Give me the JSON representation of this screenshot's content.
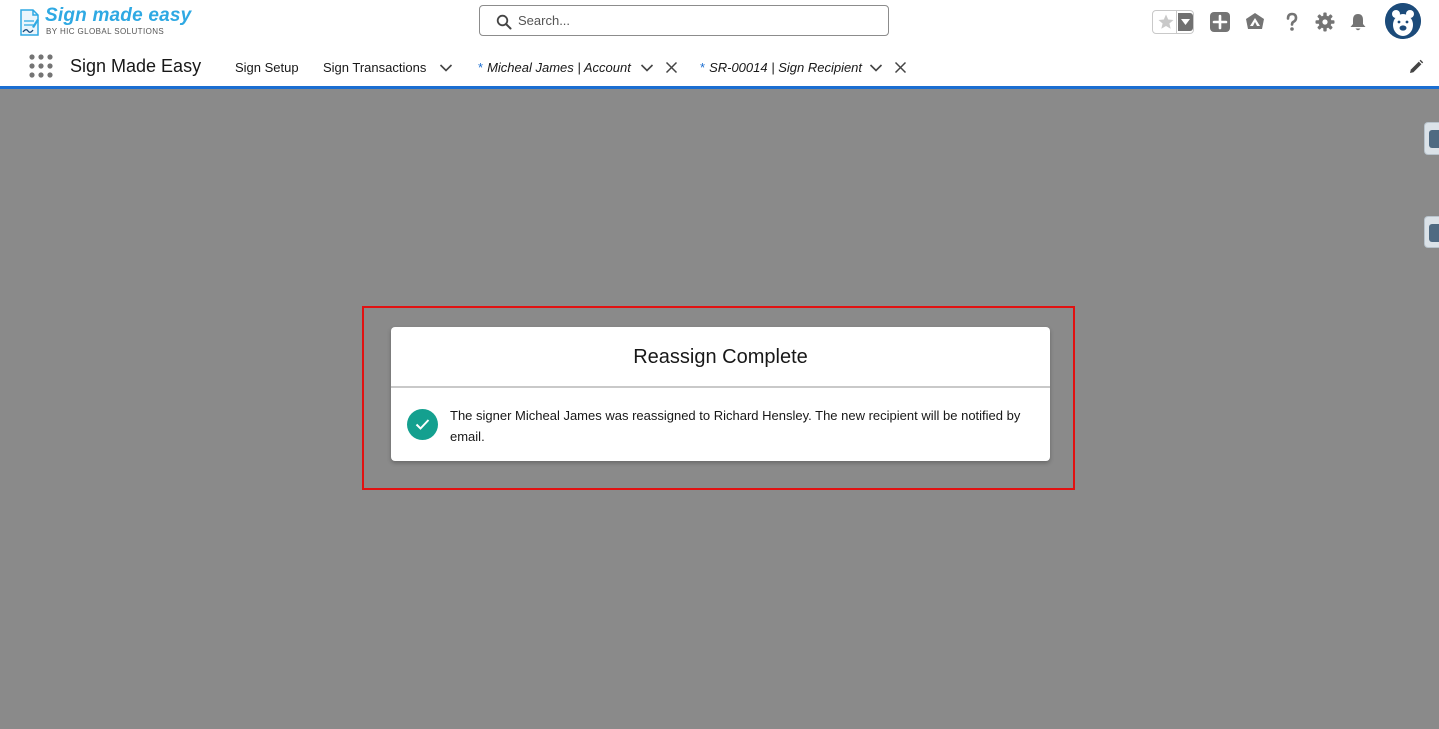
{
  "header": {
    "logo_title": "Sign made easy",
    "logo_subtitle": "BY HIC GLOBAL SOLUTIONS",
    "search_placeholder": "Search..."
  },
  "nav": {
    "app_name": "Sign Made Easy",
    "items": [
      {
        "label": "Sign Setup"
      },
      {
        "label": "Sign Transactions"
      }
    ],
    "tabs": [
      {
        "marker": "*",
        "label": "Micheal James | Account"
      },
      {
        "marker": "*",
        "label": "SR-00014 | Sign Recipient"
      }
    ]
  },
  "modal": {
    "title": "Reassign Complete",
    "message": "The signer Micheal James was reassigned to Richard Hensley. The new recipient will be notified by email."
  },
  "colors": {
    "accent": "#1b6ed1",
    "success": "#14a08f",
    "highlight": "#e21111",
    "overlay": "#8a8a8a",
    "logo": "#2fa9e3"
  },
  "icons": {
    "search": "search-icon",
    "favorites": "star-icon",
    "add": "plus-icon",
    "trailhead": "trailhead-icon",
    "help": "question-icon",
    "setup": "gear-icon",
    "notifications": "bell-icon",
    "avatar": "bear-avatar-icon",
    "launcher": "app-launcher-icon",
    "edit": "pencil-icon"
  }
}
